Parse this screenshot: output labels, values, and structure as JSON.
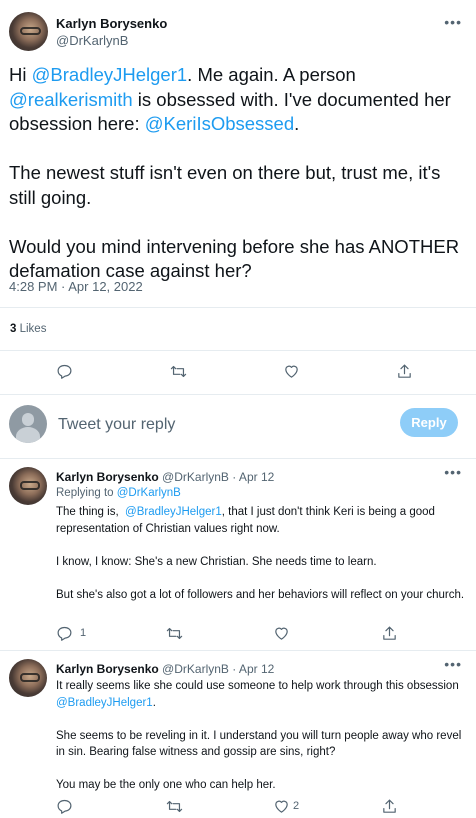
{
  "main_tweet": {
    "author_name": "Karlyn Borysenko",
    "author_handle": "@DrKarlynB",
    "text_parts": [
      {
        "t": "Hi ",
        "link": false
      },
      {
        "t": "@BradleyJHelger1",
        "link": true
      },
      {
        "t": ". Me again. A person ",
        "link": false
      },
      {
        "t": "@realkerismith",
        "link": true
      },
      {
        "t": " is obsessed with. I've documented her obsession here: ",
        "link": false
      },
      {
        "t": "@KeriIsObsessed",
        "link": true
      },
      {
        "t": ".\n\nThe newest stuff isn't even on there but, trust me, it's still going.\n\nWould you mind intervening before she has ANOTHER defamation case against her?",
        "link": false
      }
    ],
    "timestamp": "4:28 PM · Apr 12, 2022",
    "likes_count": "3",
    "likes_label": "Likes"
  },
  "reply_composer": {
    "placeholder": "Tweet your reply",
    "button_label": "Reply"
  },
  "replies": [
    {
      "author_name": "Karlyn Borysenko",
      "author_handle": "@DrKarlynB",
      "date": "· Apr 12",
      "replying_to_label": "Replying to",
      "replying_to_handle": "@DrKarlynB",
      "text_parts": [
        {
          "t": "The thing is,  ",
          "link": false
        },
        {
          "t": "@BradleyJHelger1",
          "link": true
        },
        {
          "t": ", that I just don't think Keri is being a good representation of Christian values right now.\n\nI know, I know: She's a new Christian. She needs time to learn.\n\nBut she's also got a lot of followers and her behaviors will reflect on your church.",
          "link": false
        }
      ],
      "reply_count": "1",
      "retweet_count": "",
      "like_count": ""
    },
    {
      "author_name": "Karlyn Borysenko",
      "author_handle": "@DrKarlynB",
      "date": "· Apr 12",
      "text_parts": [
        {
          "t": "It really seems like she could use someone to help work through this obsession ",
          "link": false
        },
        {
          "t": "@BradleyJHelger1",
          "link": true
        },
        {
          "t": ".\n\nShe seems to be reveling in it. I understand you will turn people away who revel in sin. Bearing false witness and gossip are sins, right?\n\nYou may be the only one who can help her.",
          "link": false
        }
      ],
      "reply_count": "",
      "retweet_count": "",
      "like_count": "2"
    }
  ],
  "icons": {
    "more": "more-icon",
    "reply": "reply-icon",
    "retweet": "retweet-icon",
    "like": "like-icon",
    "share": "share-icon"
  },
  "colors": {
    "link": "#1d9bf0",
    "secondary_text": "#536471",
    "reply_button_disabled": "#8ecdf8"
  }
}
